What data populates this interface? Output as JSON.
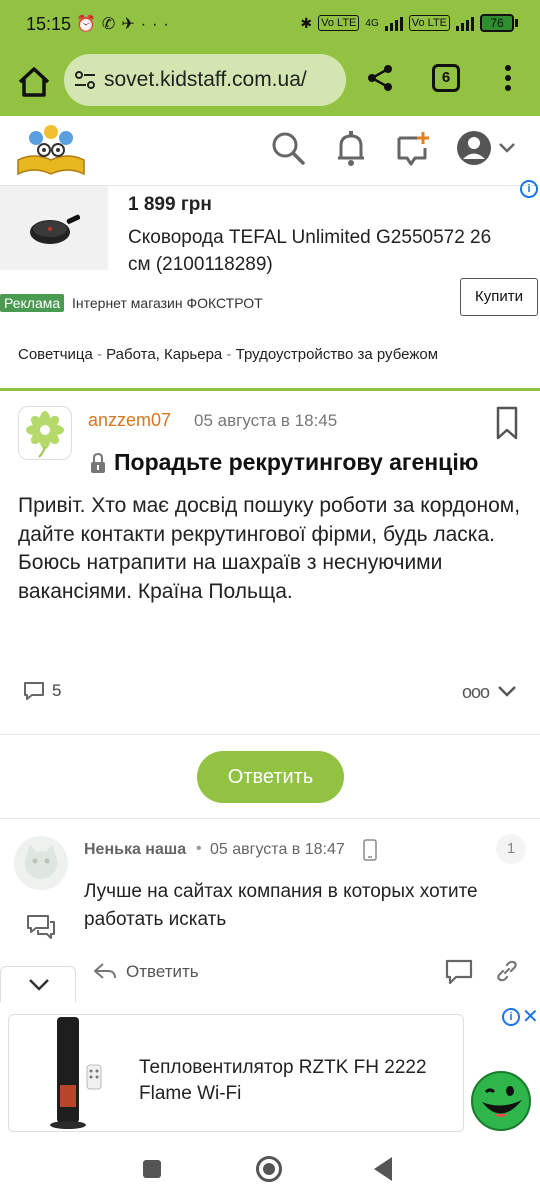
{
  "status_bar": {
    "time": "15:15",
    "network_badge_1": "Vo LTE",
    "network_4g": "4G",
    "network_badge_2": "Vo LTE",
    "battery": "76"
  },
  "browser": {
    "url": "sovet.kidstaff.com.ua/",
    "tab_count": "6"
  },
  "ad_top": {
    "price": "1 899 грн",
    "title": "Сковорода TEFAL Unlimited G2550572 26 см (2100118289)",
    "badge": "Реклама",
    "shop": "Інтернет магазин ФОКСТРОТ",
    "buy_label": "Купити",
    "info": "i"
  },
  "breadcrumbs": [
    "Советчица",
    "Работа, Карьера",
    "Трудоустройство за рубежом"
  ],
  "breadcrumb_separator": "-",
  "post": {
    "author": "anzzem07",
    "date": "05 августа в 18:45",
    "title": "Порадьте рекрутингову агенцію",
    "body": "Привіт. Хто має досвід пошуку роботи за кордоном, дайте контакти рекрутингової фірми, будь ласка. Боюсь натрапити на шахраїв з неснуючими вакансіями. Країна Польща.",
    "comments_count": "5"
  },
  "reply_button": "Ответить",
  "comment": {
    "author": "Ненька наша",
    "separator": "•",
    "date": "05 августа в 18:47",
    "number": "1",
    "text": "Лучше на сайтах компания в которых хотите работать искать",
    "reply_label": "Ответить"
  },
  "ad_bottom": {
    "title": "Тепловентилятор RZTK FH 2222 Flame Wi-Fi",
    "info": "i",
    "close": "✕"
  },
  "colors": {
    "brand_green": "#92c242",
    "author_orange": "#d9771e",
    "ad_badge_green": "#4a9a52",
    "ad_info_blue": "#1a73e8"
  }
}
